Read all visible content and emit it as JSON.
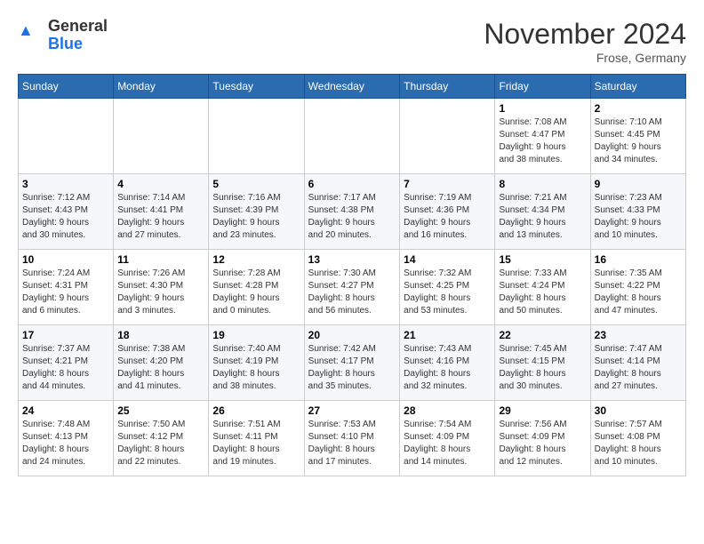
{
  "header": {
    "logo_general": "General",
    "logo_blue": "Blue",
    "month_title": "November 2024",
    "location": "Frose, Germany"
  },
  "days_of_week": [
    "Sunday",
    "Monday",
    "Tuesday",
    "Wednesday",
    "Thursday",
    "Friday",
    "Saturday"
  ],
  "weeks": [
    {
      "days": [
        {
          "num": "",
          "info": ""
        },
        {
          "num": "",
          "info": ""
        },
        {
          "num": "",
          "info": ""
        },
        {
          "num": "",
          "info": ""
        },
        {
          "num": "",
          "info": ""
        },
        {
          "num": "1",
          "info": "Sunrise: 7:08 AM\nSunset: 4:47 PM\nDaylight: 9 hours\nand 38 minutes."
        },
        {
          "num": "2",
          "info": "Sunrise: 7:10 AM\nSunset: 4:45 PM\nDaylight: 9 hours\nand 34 minutes."
        }
      ]
    },
    {
      "days": [
        {
          "num": "3",
          "info": "Sunrise: 7:12 AM\nSunset: 4:43 PM\nDaylight: 9 hours\nand 30 minutes."
        },
        {
          "num": "4",
          "info": "Sunrise: 7:14 AM\nSunset: 4:41 PM\nDaylight: 9 hours\nand 27 minutes."
        },
        {
          "num": "5",
          "info": "Sunrise: 7:16 AM\nSunset: 4:39 PM\nDaylight: 9 hours\nand 23 minutes."
        },
        {
          "num": "6",
          "info": "Sunrise: 7:17 AM\nSunset: 4:38 PM\nDaylight: 9 hours\nand 20 minutes."
        },
        {
          "num": "7",
          "info": "Sunrise: 7:19 AM\nSunset: 4:36 PM\nDaylight: 9 hours\nand 16 minutes."
        },
        {
          "num": "8",
          "info": "Sunrise: 7:21 AM\nSunset: 4:34 PM\nDaylight: 9 hours\nand 13 minutes."
        },
        {
          "num": "9",
          "info": "Sunrise: 7:23 AM\nSunset: 4:33 PM\nDaylight: 9 hours\nand 10 minutes."
        }
      ]
    },
    {
      "days": [
        {
          "num": "10",
          "info": "Sunrise: 7:24 AM\nSunset: 4:31 PM\nDaylight: 9 hours\nand 6 minutes."
        },
        {
          "num": "11",
          "info": "Sunrise: 7:26 AM\nSunset: 4:30 PM\nDaylight: 9 hours\nand 3 minutes."
        },
        {
          "num": "12",
          "info": "Sunrise: 7:28 AM\nSunset: 4:28 PM\nDaylight: 9 hours\nand 0 minutes."
        },
        {
          "num": "13",
          "info": "Sunrise: 7:30 AM\nSunset: 4:27 PM\nDaylight: 8 hours\nand 56 minutes."
        },
        {
          "num": "14",
          "info": "Sunrise: 7:32 AM\nSunset: 4:25 PM\nDaylight: 8 hours\nand 53 minutes."
        },
        {
          "num": "15",
          "info": "Sunrise: 7:33 AM\nSunset: 4:24 PM\nDaylight: 8 hours\nand 50 minutes."
        },
        {
          "num": "16",
          "info": "Sunrise: 7:35 AM\nSunset: 4:22 PM\nDaylight: 8 hours\nand 47 minutes."
        }
      ]
    },
    {
      "days": [
        {
          "num": "17",
          "info": "Sunrise: 7:37 AM\nSunset: 4:21 PM\nDaylight: 8 hours\nand 44 minutes."
        },
        {
          "num": "18",
          "info": "Sunrise: 7:38 AM\nSunset: 4:20 PM\nDaylight: 8 hours\nand 41 minutes."
        },
        {
          "num": "19",
          "info": "Sunrise: 7:40 AM\nSunset: 4:19 PM\nDaylight: 8 hours\nand 38 minutes."
        },
        {
          "num": "20",
          "info": "Sunrise: 7:42 AM\nSunset: 4:17 PM\nDaylight: 8 hours\nand 35 minutes."
        },
        {
          "num": "21",
          "info": "Sunrise: 7:43 AM\nSunset: 4:16 PM\nDaylight: 8 hours\nand 32 minutes."
        },
        {
          "num": "22",
          "info": "Sunrise: 7:45 AM\nSunset: 4:15 PM\nDaylight: 8 hours\nand 30 minutes."
        },
        {
          "num": "23",
          "info": "Sunrise: 7:47 AM\nSunset: 4:14 PM\nDaylight: 8 hours\nand 27 minutes."
        }
      ]
    },
    {
      "days": [
        {
          "num": "24",
          "info": "Sunrise: 7:48 AM\nSunset: 4:13 PM\nDaylight: 8 hours\nand 24 minutes."
        },
        {
          "num": "25",
          "info": "Sunrise: 7:50 AM\nSunset: 4:12 PM\nDaylight: 8 hours\nand 22 minutes."
        },
        {
          "num": "26",
          "info": "Sunrise: 7:51 AM\nSunset: 4:11 PM\nDaylight: 8 hours\nand 19 minutes."
        },
        {
          "num": "27",
          "info": "Sunrise: 7:53 AM\nSunset: 4:10 PM\nDaylight: 8 hours\nand 17 minutes."
        },
        {
          "num": "28",
          "info": "Sunrise: 7:54 AM\nSunset: 4:09 PM\nDaylight: 8 hours\nand 14 minutes."
        },
        {
          "num": "29",
          "info": "Sunrise: 7:56 AM\nSunset: 4:09 PM\nDaylight: 8 hours\nand 12 minutes."
        },
        {
          "num": "30",
          "info": "Sunrise: 7:57 AM\nSunset: 4:08 PM\nDaylight: 8 hours\nand 10 minutes."
        }
      ]
    }
  ]
}
